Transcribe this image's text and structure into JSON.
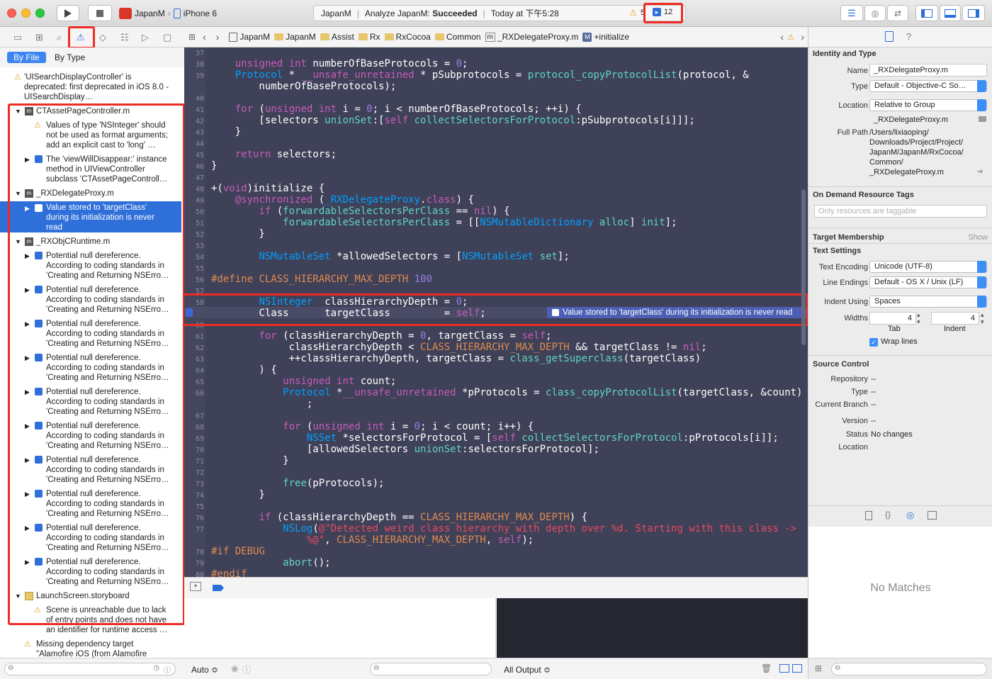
{
  "toolbar": {
    "scheme_name": "JapanM",
    "device": "iPhone 6",
    "activity_project": "JapanM",
    "activity_action": "Analyze JapanM:",
    "activity_status": "Succeeded",
    "activity_time": "Today at 下午5:28",
    "warning_count": "5",
    "issue_count": "12"
  },
  "navigator": {
    "filter_by_file": "By File",
    "filter_by_type": "By Type",
    "top_issue": "'UISearchDisplayController' is deprecated: first deprecated in iOS 8.0 - UISearchDisplay…",
    "groups": [
      {
        "file": "CTAssetPageController.m",
        "issues": [
          "Values of type 'NSInteger' should not be used as format arguments; add an explicit cast to 'long' …",
          "The 'viewWillDisappear:' instance method in UIViewController subclass 'CTAssetPageControll…"
        ]
      },
      {
        "file": "_RXDelegateProxy.m",
        "issues": [
          "Value stored to 'targetClass' during its initialization is never read"
        ]
      },
      {
        "file": "_RXObjCRuntime.m",
        "issue_text": "Potential null dereference. According to coding standards in 'Creating and Returning NSErro…"
      },
      {
        "file": "LaunchScreen.storyboard",
        "issues": [
          "Scene is unreachable due to lack of entry points and does not have an identifier for runtime access …"
        ]
      }
    ],
    "bottom_issue": "Missing dependency target \"Alamofire iOS (from Alamofire"
  },
  "jumpbar": {
    "crumbs": [
      "JapanM",
      "JapanM",
      "Assist",
      "Rx",
      "RxCocoa",
      "Common",
      "_RXDelegateProxy.m",
      "+initialize"
    ]
  },
  "editor": {
    "line_numbers": [
      "37",
      "38",
      "39",
      "",
      "40",
      "41",
      "42",
      "43",
      "44",
      "45",
      "46",
      "47",
      "48",
      "49",
      "50",
      "51",
      "52",
      "53",
      "54",
      "55",
      "56",
      "57",
      "58",
      "59",
      "60",
      "61",
      "62",
      "63",
      "64",
      "65",
      "66",
      "",
      "67",
      "68",
      "69",
      "70",
      "71",
      "72",
      "73",
      "74",
      "75",
      "76",
      "77",
      "",
      "78",
      "79",
      "80"
    ],
    "issue_banner": "Value stored to 'targetClass' during its initialization is never read"
  },
  "debug": {
    "auto_label": "Auto ≎",
    "output_label": "All Output ≎"
  },
  "inspector": {
    "identity_title": "Identity and Type",
    "name_label": "Name",
    "name_value": "_RXDelegateProxy.m",
    "type_label": "Type",
    "type_value": "Default - Objective-C So…",
    "location_label": "Location",
    "location_value": "Relative to Group",
    "location_file": "_RXDelegateProxy.m",
    "fullpath_label": "Full Path",
    "fullpath_lines": [
      "/Users/lixiaoping/",
      "Downloads/Project/Project/",
      "JapanM/JapanM/RxCocoa/",
      "Common/",
      "_RXDelegateProxy.m"
    ],
    "odr_title": "On Demand Resource Tags",
    "odr_placeholder": "Only resources are taggable",
    "target_title": "Target Membership",
    "target_show": "Show",
    "text_title": "Text Settings",
    "encoding_label": "Text Encoding",
    "encoding_value": "Unicode (UTF-8)",
    "endings_label": "Line Endings",
    "endings_value": "Default - OS X / Unix (LF)",
    "indent_label": "Indent Using",
    "indent_value": "Spaces",
    "widths_label": "Widths",
    "tab_value": "4",
    "indent_width_value": "4",
    "tab_caption": "Tab",
    "indent_caption": "Indent",
    "wrap_label": "Wrap lines",
    "sc_title": "Source Control",
    "repo_label": "Repository",
    "repo_value": "--",
    "sctype_label": "Type",
    "sctype_value": "--",
    "branch_label": "Current Branch",
    "branch_value": "--",
    "version_label": "Version",
    "version_value": "--",
    "status_label": "Status",
    "status_value": "No changes",
    "sclocation_label": "Location",
    "no_matches": "No Matches"
  }
}
